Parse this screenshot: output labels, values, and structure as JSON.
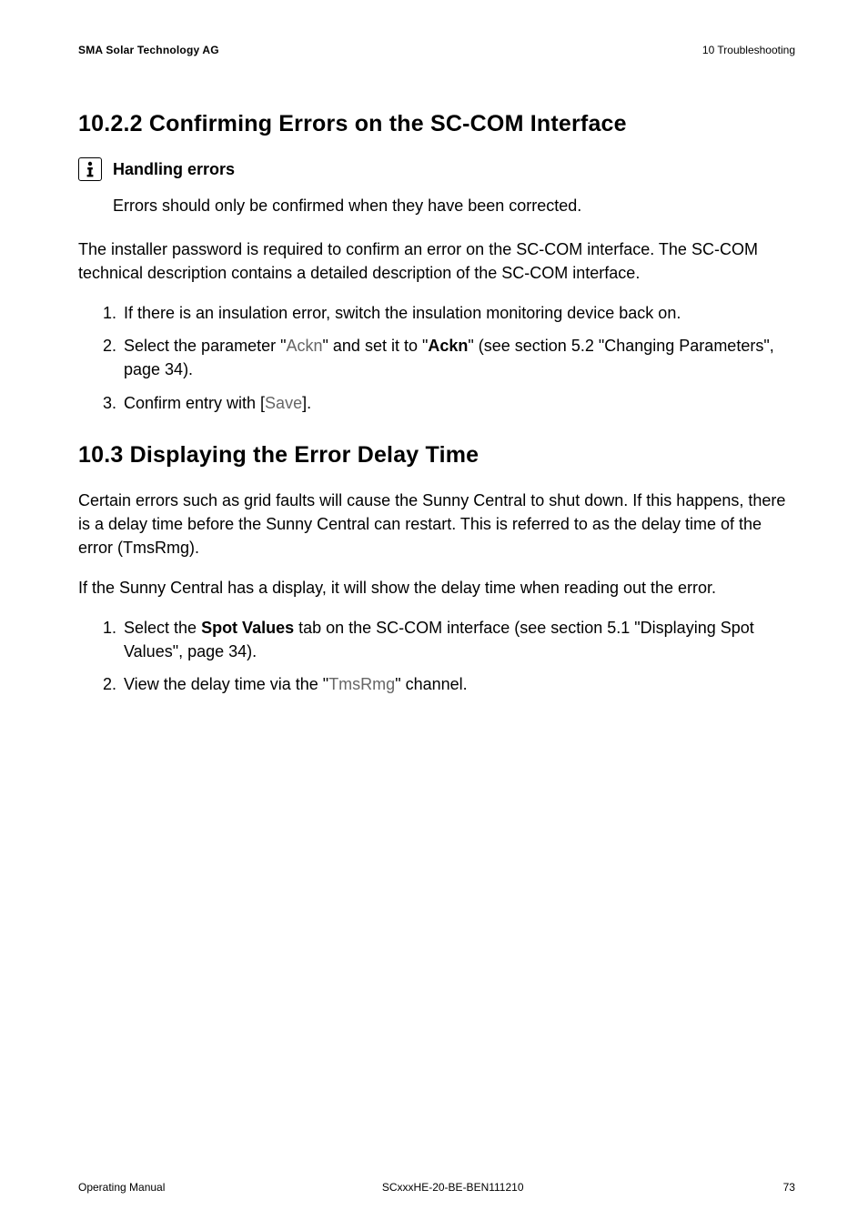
{
  "header": {
    "company": "SMA Solar Technology AG",
    "chapter": "10  Troubleshooting"
  },
  "section1": {
    "title": "10.2.2  Confirming Errors on the SC-COM Interface",
    "note_title": "Handling errors",
    "note_body": "Errors should only be confirmed when they have been corrected.",
    "intro": "The installer password is required to confirm an error on the SC-COM interface. The SC-COM technical description contains a detailed description of the SC-COM interface.",
    "steps": {
      "s1": "If there is an insulation error, switch the insulation monitoring device back on.",
      "s2a": "Select the parameter \"",
      "s2b": "Ackn",
      "s2c": "\" and set it to \"",
      "s2d": "Ackn",
      "s2e": "\" (see section 5.2 \"Changing Parameters\", page 34).",
      "s3a": "Confirm entry with [",
      "s3b": "Save",
      "s3c": "]."
    }
  },
  "section2": {
    "title": "10.3  Displaying the Error Delay Time",
    "para1": "Certain errors such as grid faults will cause the Sunny Central to shut down. If this happens, there is a delay time before the Sunny Central can restart. This is referred to as the delay time of the error (TmsRmg).",
    "para2": "If the Sunny Central has a display, it will show the delay time when reading out the error.",
    "steps": {
      "s1a": "Select the ",
      "s1b": "Spot Values",
      "s1c": " tab on the SC-COM interface (see section 5.1 \"Displaying Spot Values\", page 34).",
      "s2a": "View the delay time via the \"",
      "s2b": "TmsRmg",
      "s2c": "\" channel."
    }
  },
  "footer": {
    "docname": "Operating Manual",
    "docid": "SCxxxHE-20-BE-BEN111210",
    "page": "73"
  }
}
